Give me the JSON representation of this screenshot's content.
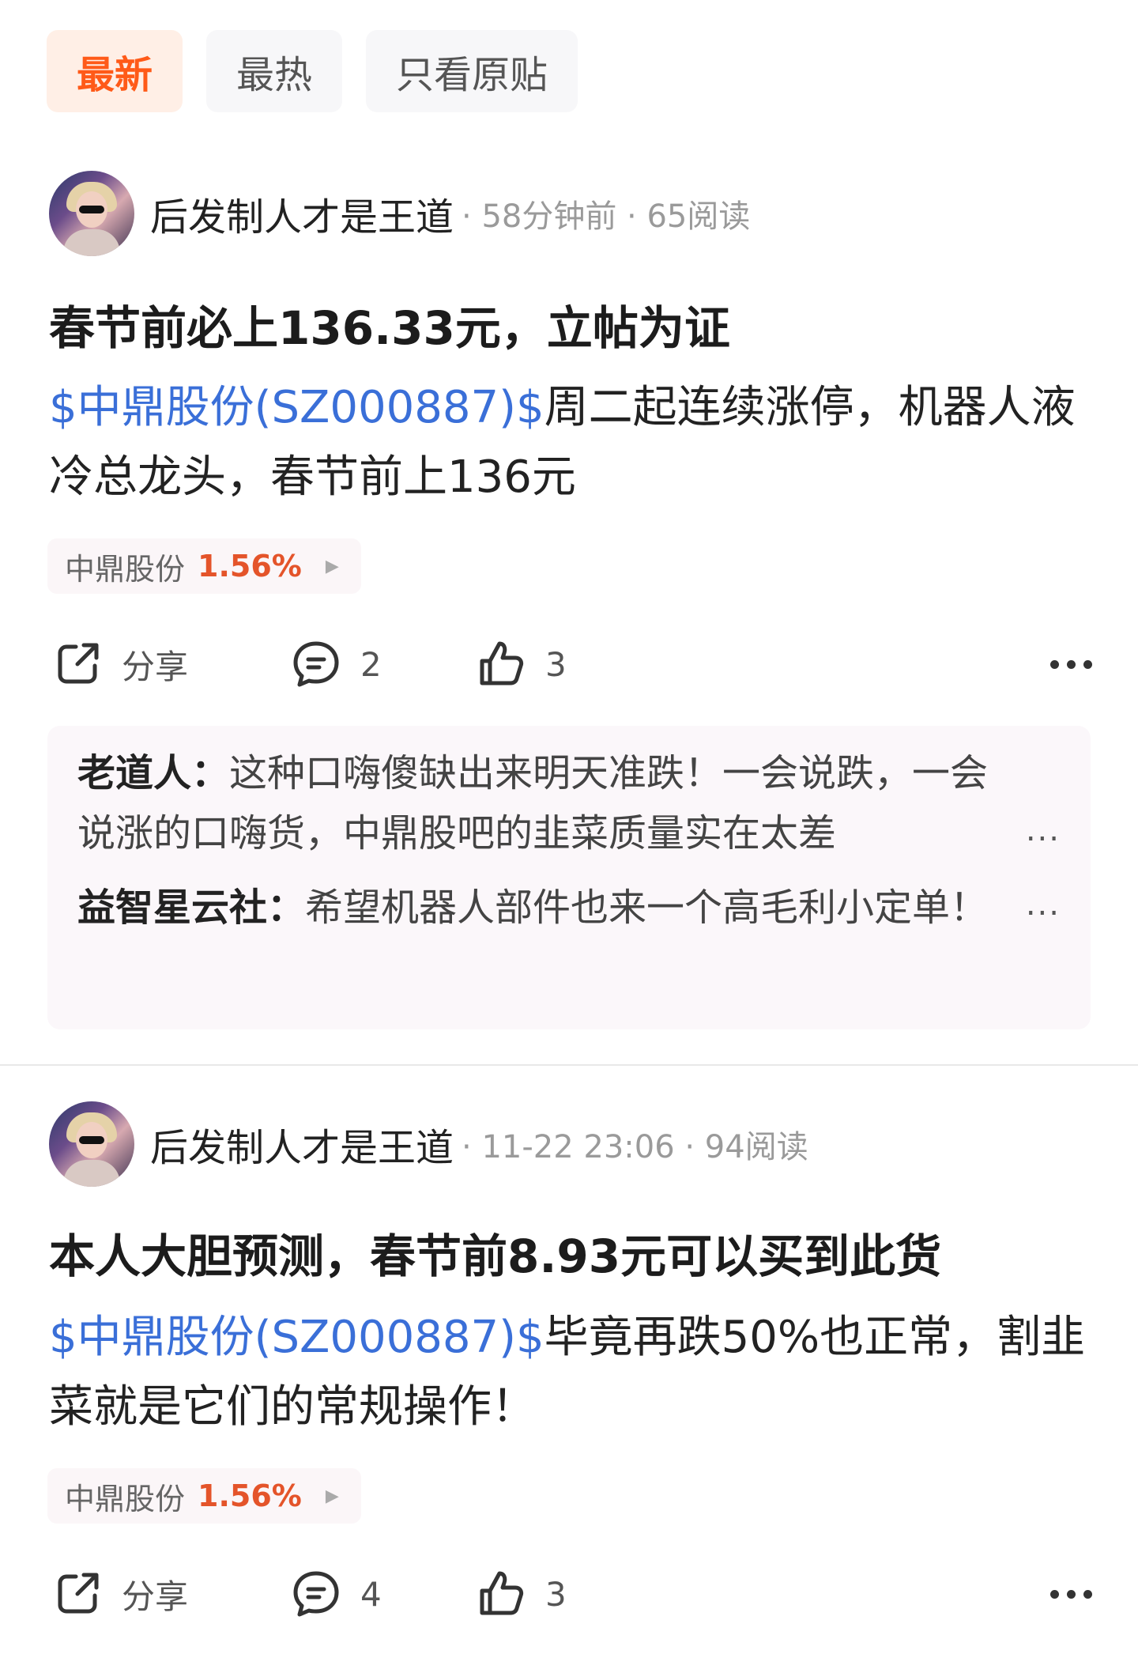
{
  "tabs": [
    {
      "label": "最新",
      "active": true
    },
    {
      "label": "最热",
      "active": false
    },
    {
      "label": "只看原贴",
      "active": false
    }
  ],
  "posts": [
    {
      "author": "后发制人才是王道",
      "meta": "· 58分钟前 · 65阅读",
      "title": "春节前必上136.33元，立帖为证",
      "stock_link": "$中鼎股份(SZ000887)$",
      "body": "周二起连续涨停，机器人液冷总龙头，春节前上136元",
      "stock_chip": {
        "name": "中鼎股份",
        "change": "1.56%"
      },
      "share_label": "分享",
      "comment_count": "2",
      "like_count": "3",
      "comments": [
        {
          "user": "老道人",
          "text": "这种口嗨傻缺出来明天准跌！一会说跌，一会说涨的口嗨货，中鼎股吧的韭菜质量实在太差"
        },
        {
          "user": "益智星云社",
          "text": "希望机器人部件也来一个高毛利小定单！"
        }
      ]
    },
    {
      "author": "后发制人才是王道",
      "meta": "· 11-22 23:06 · 94阅读",
      "title": "本人大胆预测，春节前8.93元可以买到此货",
      "stock_link": "$中鼎股份(SZ000887)$",
      "body": "毕竟再跌50%也正常，割韭菜就是它们的常规操作！",
      "stock_chip": {
        "name": "中鼎股份",
        "change": "1.56%"
      },
      "share_label": "分享",
      "comment_count": "4",
      "like_count": "3"
    }
  ],
  "colors": {
    "accent": "#ff5a18",
    "link": "#3a6fd8",
    "rise": "#e4542a"
  },
  "icons": [
    "share-icon",
    "comment-icon",
    "thumbs-up-icon",
    "more-icon"
  ],
  "comment_separator": "：",
  "ellipsis": "..."
}
